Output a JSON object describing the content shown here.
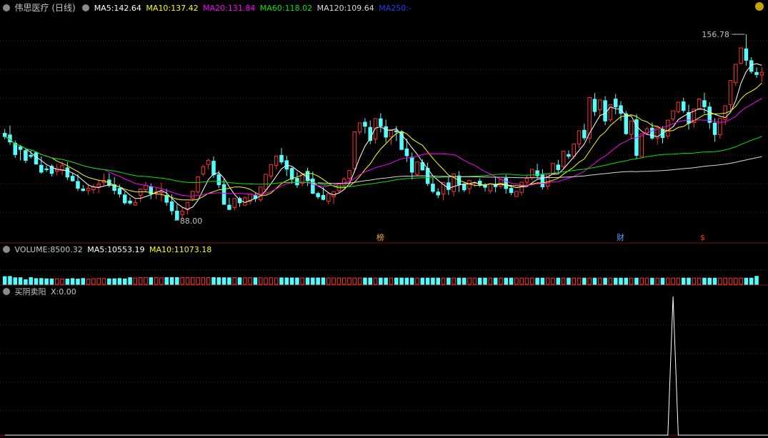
{
  "colors": {
    "bg": "#000000",
    "grid": "#7a1414",
    "up": "#ff3232",
    "down": "#54fcfc",
    "ma5": "#ffffff",
    "ma10": "#ffff00",
    "ma20": "#ff00ff",
    "ma60": "#00e600",
    "ma120": "#d8d8d8",
    "ma250": "#1e3cff",
    "peak": "#ffffff",
    "text": "#c0c0c0"
  },
  "price_panel": {
    "title": "伟思医疗 (日线)",
    "ma5_label": "MA5:",
    "ma5_value": "142.64",
    "ma10_label": "MA10:",
    "ma10_value": "137.42",
    "ma20_label": "MA20:",
    "ma20_value": "131.84",
    "ma60_label": "MA60:",
    "ma60_value": "118.02",
    "ma120_label": "MA120:",
    "ma120_value": "109.64",
    "ma250_label": "MA250:",
    "ma250_value": "-",
    "high_label": "156.78",
    "low_label": "88.00",
    "event_markers": [
      {
        "glyph": "榜",
        "color": "#ffa040"
      },
      {
        "glyph": "财",
        "color": "#5aa0ff"
      },
      {
        "glyph": "$",
        "color": "#ff3232"
      }
    ]
  },
  "volume_panel": {
    "name": "VOLUME:",
    "value": "8500.32",
    "ma5_label": "MA5:",
    "ma5_value": "10553.19",
    "ma10_label": "MA10:",
    "ma10_value": "11073.18"
  },
  "indicator_panel": {
    "name": "买阴卖阳",
    "x_label": "X:",
    "x_value": "0.00"
  },
  "chart_data": {
    "type": "candlestick",
    "price_range": [
      80,
      165
    ],
    "high": 156.78,
    "low": 88.0,
    "candles": [
      [
        119.97,
        121.54,
        118.75,
        117.8,
        "d"
      ],
      [
        119.35,
        122.87,
        116.74,
        115.65,
        "d"
      ],
      [
        116.3,
        117.29,
        112.03,
        110.92,
        "d"
      ],
      [
        114.94,
        115.68,
        113.96,
        109.86,
        "d"
      ],
      [
        113.53,
        114.47,
        109.89,
        108.83,
        "d"
      ],
      [
        111.81,
        113.55,
        111.36,
        110.56,
        "d"
      ],
      [
        112.76,
        113.23,
        108.52,
        108.34,
        "d"
      ],
      [
        108.06,
        111.34,
        105.52,
        104.87,
        "d"
      ],
      [
        106.72,
        107.95,
        106.46,
        105.6,
        "d"
      ],
      [
        107.71,
        108.44,
        105.04,
        103.93,
        "d"
      ],
      [
        105.83,
        108.61,
        106.96,
        104.35,
        "u"
      ],
      [
        106.12,
        109.51,
        107.9,
        104.47,
        "u"
      ],
      [
        107.11,
        109.31,
        103.68,
        102.55,
        "d"
      ],
      [
        104.0,
        105.25,
        102.29,
        101.99,
        "d"
      ],
      [
        102.07,
        104.75,
        99.53,
        98.49,
        "d"
      ],
      [
        99.29,
        100.74,
        98.68,
        98.27,
        "d"
      ],
      [
        98.63,
        100.59,
        99.49,
        97.15,
        "u"
      ],
      [
        98.99,
        101.1,
        100.1,
        97.62,
        "u"
      ],
      [
        100.16,
        102.8,
        101.03,
        97.71,
        "u"
      ],
      [
        101.63,
        104.99,
        102.45,
        100.49,
        "u"
      ],
      [
        102.6,
        105.15,
        100.64,
        99.82,
        "d"
      ],
      [
        100.84,
        103.66,
        98.72,
        97.2,
        "d"
      ],
      [
        99.48,
        100.91,
        97.36,
        96.11,
        "d"
      ],
      [
        97.05,
        98.3,
        94.1,
        93.43,
        "d"
      ],
      [
        94.79,
        96.15,
        94.02,
        93.39,
        "d"
      ],
      [
        93.28,
        95.33,
        94.24,
        93.03,
        "u"
      ],
      [
        96.89,
        98.85,
        99.26,
        94.39,
        "u"
      ],
      [
        98.98,
        101.96,
        100.62,
        97.96,
        "u"
      ],
      [
        100.15,
        101.35,
        97.46,
        95.48,
        "d"
      ],
      [
        97.94,
        99.66,
        98.16,
        95.59,
        "u"
      ],
      [
        97.85,
        101.6,
        98.03,
        94.63,
        "u"
      ],
      [
        96.85,
        99.29,
        94.32,
        93.01,
        "d"
      ],
      [
        94.51,
        97.3,
        91.14,
        89.59,
        "d"
      ],
      [
        91.03,
        93.58,
        88.0,
        87.68,
        "d"
      ],
      [
        89.76,
        92.32,
        90.94,
        88.12,
        "u"
      ],
      [
        91.57,
        94.11,
        94.25,
        89.69,
        "u"
      ],
      [
        95.76,
        97.77,
        98.39,
        94.8,
        "u"
      ],
      [
        98.15,
        100.6,
        103.74,
        97.51,
        "u"
      ],
      [
        104.82,
        108.24,
        107.56,
        104.06,
        "u"
      ],
      [
        108.36,
        110.5,
        109.93,
        106.47,
        "u"
      ],
      [
        109.59,
        111.35,
        104.54,
        103.34,
        "d"
      ],
      [
        104.56,
        106.05,
        100.81,
        99.57,
        "d"
      ],
      [
        100.89,
        103.21,
        93.55,
        93.4,
        "d"
      ],
      [
        93.24,
        95.92,
        91.64,
        91.34,
        "d"
      ],
      [
        92.39,
        93.04,
        95.73,
        91.38,
        "u"
      ],
      [
        95.75,
        96.38,
        94.11,
        92.62,
        "d"
      ],
      [
        93.27,
        96.59,
        95.97,
        92.89,
        "u"
      ],
      [
        94.64,
        96.53,
        97.39,
        93.51,
        "u"
      ],
      [
        96.81,
        97.73,
        95.66,
        94.43,
        "d"
      ],
      [
        95.21,
        98.05,
        99.98,
        94.48,
        "u"
      ],
      [
        99.11,
        102.0,
        104.74,
        97.84,
        "u"
      ],
      [
        104.1,
        107.69,
        108.33,
        103.17,
        "u"
      ],
      [
        108.05,
        109.96,
        111.51,
        106.51,
        "u"
      ],
      [
        111.76,
        114.5,
        109.3,
        108.32,
        "d"
      ],
      [
        109.78,
        111.59,
        106.64,
        104.08,
        "d"
      ],
      [
        106.91,
        107.37,
        102.87,
        101.15,
        "d"
      ],
      [
        103.23,
        105.57,
        100.76,
        99.64,
        "d"
      ],
      [
        101.34,
        103.25,
        104.99,
        100.3,
        "u"
      ],
      [
        105.84,
        107.17,
        102.33,
        100.28,
        "d"
      ],
      [
        102.98,
        105.76,
        97.65,
        97.32,
        "d"
      ],
      [
        97.59,
        98.27,
        96.36,
        95.53,
        "d"
      ],
      [
        96.88,
        99.9,
        95.37,
        95.01,
        "d"
      ],
      [
        94.66,
        97.58,
        97.46,
        93.54,
        "u"
      ],
      [
        96.39,
        97.68,
        98.32,
        93.64,
        "u"
      ],
      [
        98.67,
        99.95,
        101.33,
        97.97,
        "u"
      ],
      [
        100.77,
        103.6,
        102.9,
        100.01,
        "u"
      ],
      [
        103.18,
        105.36,
        106.14,
        101.09,
        "u"
      ],
      [
        106.82,
        109.66,
        120.52,
        105.37,
        "u"
      ],
      [
        120.45,
        122.54,
        123.84,
        119.47,
        "u"
      ],
      [
        124.09,
        125.56,
        122.58,
        119.91,
        "d"
      ],
      [
        122.14,
        124.69,
        117.26,
        115.89,
        "d"
      ],
      [
        117.82,
        119.94,
        125.43,
        116.08,
        "u"
      ],
      [
        125.36,
        127.43,
        122.67,
        120.3,
        "d"
      ],
      [
        122.42,
        125.04,
        118.53,
        116.5,
        "d"
      ],
      [
        118.77,
        119.35,
        121.28,
        115.73,
        "u"
      ],
      [
        120.91,
        122.69,
        120.49,
        117.06,
        "d"
      ],
      [
        120.51,
        121.21,
        113.95,
        113.65,
        "d"
      ],
      [
        114.16,
        117.95,
        111.59,
        109.31,
        "d"
      ],
      [
        111.05,
        112.77,
        105.49,
        102.79,
        "d"
      ],
      [
        104.67,
        106.15,
        109.3,
        103.88,
        "u"
      ],
      [
        109.12,
        110.36,
        106.34,
        106.07,
        "d"
      ],
      [
        106.95,
        109.06,
        101.27,
        100.35,
        "d"
      ],
      [
        101.08,
        103.52,
        98.36,
        97.66,
        "d"
      ],
      [
        98.12,
        99.53,
        97.03,
        95.89,
        "d"
      ],
      [
        97.37,
        98.06,
        101.69,
        95.05,
        "u"
      ],
      [
        101.56,
        103.87,
        99.05,
        97.07,
        "d"
      ],
      [
        98.28,
        100.01,
        104.83,
        96.55,
        "u"
      ],
      [
        104.12,
        105.88,
        100.94,
        98.15,
        "d"
      ],
      [
        101.09,
        101.6,
        98.92,
        98.16,
        "d"
      ],
      [
        99.38,
        102.06,
        102.42,
        97.42,
        "u"
      ],
      [
        101.47,
        102.2,
        101.62,
        100.03,
        "d"
      ],
      [
        102.17,
        103.22,
        100.94,
        99.98,
        "d"
      ],
      [
        100.74,
        101.49,
        99.9,
        98.38,
        "d"
      ],
      [
        98.55,
        101.3,
        101.16,
        97.53,
        "u"
      ],
      [
        100.91,
        103.72,
        100.11,
        98.06,
        "d"
      ],
      [
        100.25,
        102.1,
        102.78,
        99.41,
        "u"
      ],
      [
        103.19,
        104.58,
        99.41,
        97.56,
        "d"
      ],
      [
        99.5,
        100.81,
        97.93,
        96.99,
        "d"
      ],
      [
        96.45,
        98.35,
        98.4,
        96.72,
        "u"
      ],
      [
        98.0,
        100.14,
        101.81,
        96.84,
        "u"
      ],
      [
        101.79,
        104.48,
        103.19,
        100.81,
        "u"
      ],
      [
        103.36,
        105.74,
        106.58,
        102.45,
        "u"
      ],
      [
        106.04,
        108.65,
        104.18,
        103.05,
        "d"
      ],
      [
        104.5,
        106.6,
        100.07,
        99.05,
        "d"
      ],
      [
        100.32,
        101.4,
        104.81,
        98.97,
        "u"
      ],
      [
        104.69,
        105.82,
        108.77,
        104.52,
        "u"
      ],
      [
        108.19,
        110.13,
        106.44,
        105.56,
        "d"
      ],
      [
        107.6,
        109.55,
        113.28,
        106.7,
        "u"
      ],
      [
        112.09,
        113.58,
        111.41,
        110.38,
        "d"
      ],
      [
        111.5,
        112.45,
        115.98,
        110.45,
        "u"
      ],
      [
        115.96,
        117.47,
        120.89,
        114.37,
        "u"
      ],
      [
        121.1,
        123.51,
        118.27,
        117.33,
        "d"
      ],
      [
        118.19,
        119.9,
        133.29,
        116.26,
        "u"
      ],
      [
        132.61,
        134.9,
        128.04,
        126.37,
        "d"
      ],
      [
        128.71,
        129.9,
        132.37,
        126.28,
        "u"
      ],
      [
        132.08,
        133.77,
        124.54,
        122.99,
        "d"
      ],
      [
        124.97,
        126.17,
        130.65,
        124.27,
        "u"
      ],
      [
        132.7,
        134.55,
        129.77,
        127.03,
        "d"
      ],
      [
        130.23,
        131.95,
        127.35,
        124.6,
        "d"
      ],
      [
        127.24,
        128.27,
        119.81,
        119.4,
        "d"
      ],
      [
        119.55,
        122.47,
        124.55,
        117.75,
        "u"
      ],
      [
        125.02,
        127.1,
        111.73,
        110.4,
        "d"
      ],
      [
        111.33,
        113.17,
        119.85,
        111.2,
        "u"
      ],
      [
        119.92,
        122.29,
        121.64,
        119.6,
        "u"
      ],
      [
        121.91,
        124.01,
        118.17,
        117.58,
        "d"
      ],
      [
        118.18,
        119.49,
        122.17,
        115.7,
        "u"
      ],
      [
        121.49,
        122.6,
        118.38,
        116.19,
        "d"
      ],
      [
        118.95,
        120.82,
        124.85,
        117.88,
        "u"
      ],
      [
        125.28,
        127.21,
        128.33,
        124.28,
        "u"
      ],
      [
        128.02,
        131.12,
        131.5,
        127.49,
        "u"
      ],
      [
        131.66,
        133.2,
        128.46,
        127.66,
        "d"
      ],
      [
        127.72,
        130.63,
        123.73,
        121.31,
        "d"
      ],
      [
        123.95,
        126.79,
        128.95,
        122.03,
        "u"
      ],
      [
        128.89,
        131.32,
        132.74,
        128.53,
        "u"
      ],
      [
        132.12,
        135.11,
        129.83,
        127.31,
        "d"
      ],
      [
        129.75,
        131.55,
        124.01,
        121.56,
        "d"
      ],
      [
        123.75,
        125.53,
        119.51,
        116.81,
        "d"
      ],
      [
        119.49,
        122.44,
        125.48,
        117.97,
        "u"
      ],
      [
        125.12,
        126.3,
        130.19,
        123.08,
        "u"
      ],
      [
        130.57,
        133.45,
        139.6,
        128.34,
        "u"
      ],
      [
        138.89,
        142.12,
        145.61,
        137.5,
        "u"
      ],
      [
        145.98,
        148.19,
        151.72,
        145.45,
        "u"
      ],
      [
        151.34,
        156.78,
        147.11,
        145.13,
        "d"
      ],
      [
        146.96,
        148.27,
        142.98,
        142.16,
        "d"
      ],
      [
        142.6,
        144.43,
        141.8,
        140.58,
        "d"
      ],
      [
        141.64,
        144.53,
        142.64,
        138.96,
        "u"
      ]
    ],
    "volume": {
      "values": [
        8125,
        8347,
        6945,
        7016,
        4913,
        7116,
        6087,
        6213,
        5851,
        5766,
        5935,
        5720,
        5599,
        6102,
        5574,
        6189,
        5697,
        5955,
        6251,
        6164,
        5817,
        5892,
        6169,
        5791,
        7071,
        6745,
        7061,
        7335,
        7070,
        7187,
        6805,
        7198,
        7245,
        7174,
        7051,
        7135,
        6975,
        7036,
        7051,
        7127,
        7193,
        7025,
        7012,
        6898,
        7101,
        6929,
        6921,
        6948,
        6915,
        6902,
        6781,
        6899,
        6799,
        6856,
        6795,
        6781,
        6775,
        6821,
        6761,
        6736,
        6780,
        6800,
        6805,
        6761,
        6708,
        6764,
        6747,
        6682,
        6710,
        6692,
        6677,
        6678,
        6680,
        6669,
        6681,
        6681,
        6677,
        6659,
        6654,
        6647,
        6636,
        6648,
        6641,
        6627,
        6636,
        6631,
        6625,
        6632,
        6625,
        6617,
        6622,
        6616,
        6614,
        6613,
        6614,
        6608,
        6603,
        6603,
        6601,
        6602,
        6599,
        6598,
        6598,
        6597,
        6595,
        6597,
        6593,
        6592,
        6592,
        6591,
        6590,
        6590,
        6589,
        6589,
        6588,
        6588,
        6587,
        6587,
        6587,
        6587,
        6586,
        6586,
        6586,
        6585,
        6585,
        6585,
        6585,
        6585,
        6585,
        6585,
        6585,
        6585,
        6584,
        6584,
        6584,
        6584,
        6584,
        6584,
        6584,
        6584,
        6584,
        6584,
        6584,
        6584,
        8500
      ],
      "range": [
        0,
        30000
      ]
    },
    "indicator": {
      "values": [
        0,
        0,
        0,
        0,
        0,
        0,
        0,
        0,
        0,
        0,
        0,
        0,
        0,
        0,
        0,
        0,
        0,
        0,
        0,
        0,
        0,
        0,
        0,
        0,
        0,
        0,
        0,
        0,
        0,
        0,
        0,
        0,
        0,
        0,
        0,
        0,
        0,
        0,
        0,
        0,
        0,
        0,
        0,
        0,
        0,
        0,
        0,
        0,
        0,
        0,
        0,
        0,
        0,
        0,
        0,
        0,
        0,
        0,
        0,
        0,
        0,
        0,
        0,
        0,
        0,
        0,
        0,
        0,
        0,
        0,
        0,
        0,
        0,
        0,
        0,
        0,
        0,
        0,
        0,
        0,
        0,
        0,
        0,
        0,
        0,
        0,
        0,
        0,
        0,
        0,
        0,
        0,
        0,
        0,
        0,
        0,
        0,
        0,
        0,
        0,
        0,
        0,
        0,
        0,
        0,
        0,
        0,
        0,
        0,
        0,
        0,
        0,
        0,
        0,
        0,
        0,
        0,
        0,
        0,
        0,
        0,
        0,
        0,
        0,
        0,
        0,
        0,
        0,
        1,
        0,
        0,
        0,
        0,
        0,
        0,
        0,
        0,
        0,
        0,
        0,
        0,
        0,
        0,
        0,
        0,
        0,
        0,
        0,
        0,
        0,
        0,
        0
      ],
      "range": [
        0,
        1
      ]
    }
  }
}
